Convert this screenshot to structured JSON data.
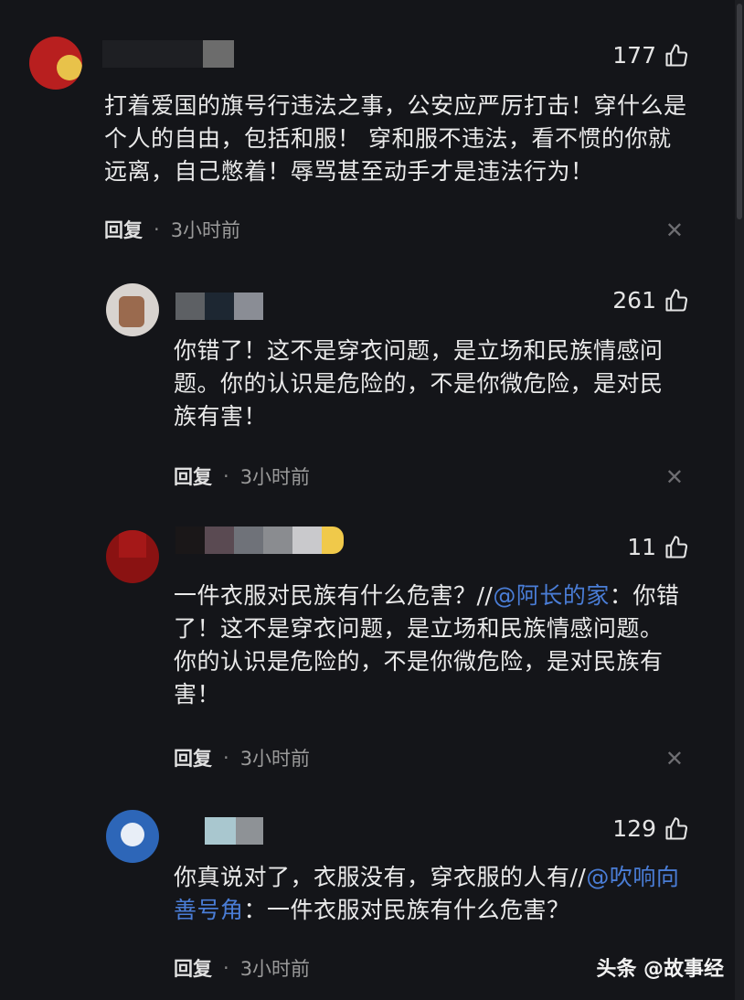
{
  "comments": [
    {
      "likes": "177",
      "text": "打着爱国的旗号行违法之事，公安应严厉打击！穿什么是个人的自由，包括和服！ 穿和服不违法，看不惯的你就远离，自己憋着！辱骂甚至动手才是违法行为！",
      "reply_label": "回复",
      "time": "3小时前"
    },
    {
      "likes": "261",
      "text": "你错了！这不是穿衣问题，是立场和民族情感问题。你的认识是危险的，不是你微危险，是对民族有害！",
      "reply_label": "回复",
      "time": "3小时前"
    },
    {
      "likes": "11",
      "text_before": "一件衣服对民族有什么危害？//",
      "mention": "@阿长的家",
      "text_after": "：你错了！这不是穿衣问题，是立场和民族情感问题。你的认识是危险的，不是你微危险，是对民族有害！",
      "reply_label": "回复",
      "time": "3小时前"
    },
    {
      "likes": "129",
      "text_before": "你真说对了，衣服没有，穿衣服的人有//",
      "mention": "@吹响向善号角",
      "text_after": "：一件衣服对民族有什么危害？",
      "reply_label": "回复",
      "time": "3小时前"
    }
  ],
  "close_glyph": "✕",
  "watermark": "头条 @故事经",
  "icons": {
    "like": "thumbs-up-icon",
    "close": "close-icon"
  }
}
